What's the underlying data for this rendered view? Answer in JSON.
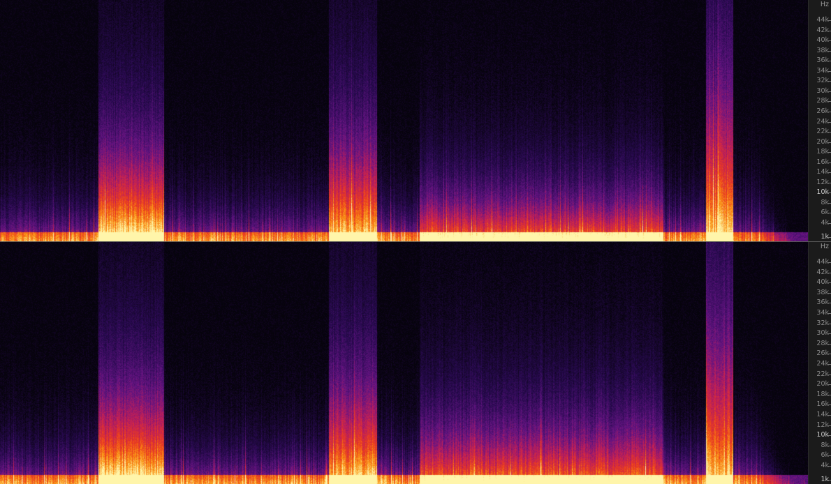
{
  "colors": {
    "background": "#000000",
    "ruler_bg": "#1b1b1b",
    "ruler_text": "#8c8c8c"
  },
  "spectrogram": {
    "channels": [
      {
        "name": "channel-1",
        "unit": "Hz",
        "labels": [
          "44k",
          "42k",
          "40k",
          "38k",
          "36k",
          "34k",
          "32k",
          "30k",
          "28k",
          "26k",
          "24k",
          "22k",
          "20k",
          "18k",
          "16k",
          "14k",
          "12k",
          "10k",
          "8k",
          "6k",
          "4k",
          "1k"
        ],
        "emphasized": [
          "10k",
          "1k"
        ]
      },
      {
        "name": "channel-2",
        "unit": "Hz",
        "labels": [
          "44k",
          "42k",
          "40k",
          "38k",
          "36k",
          "34k",
          "32k",
          "30k",
          "28k",
          "26k",
          "24k",
          "22k",
          "20k",
          "18k",
          "16k",
          "14k",
          "12k",
          "10k",
          "8k",
          "6k",
          "4k",
          "1k"
        ],
        "emphasized": [
          "10k",
          "1k"
        ]
      }
    ]
  }
}
